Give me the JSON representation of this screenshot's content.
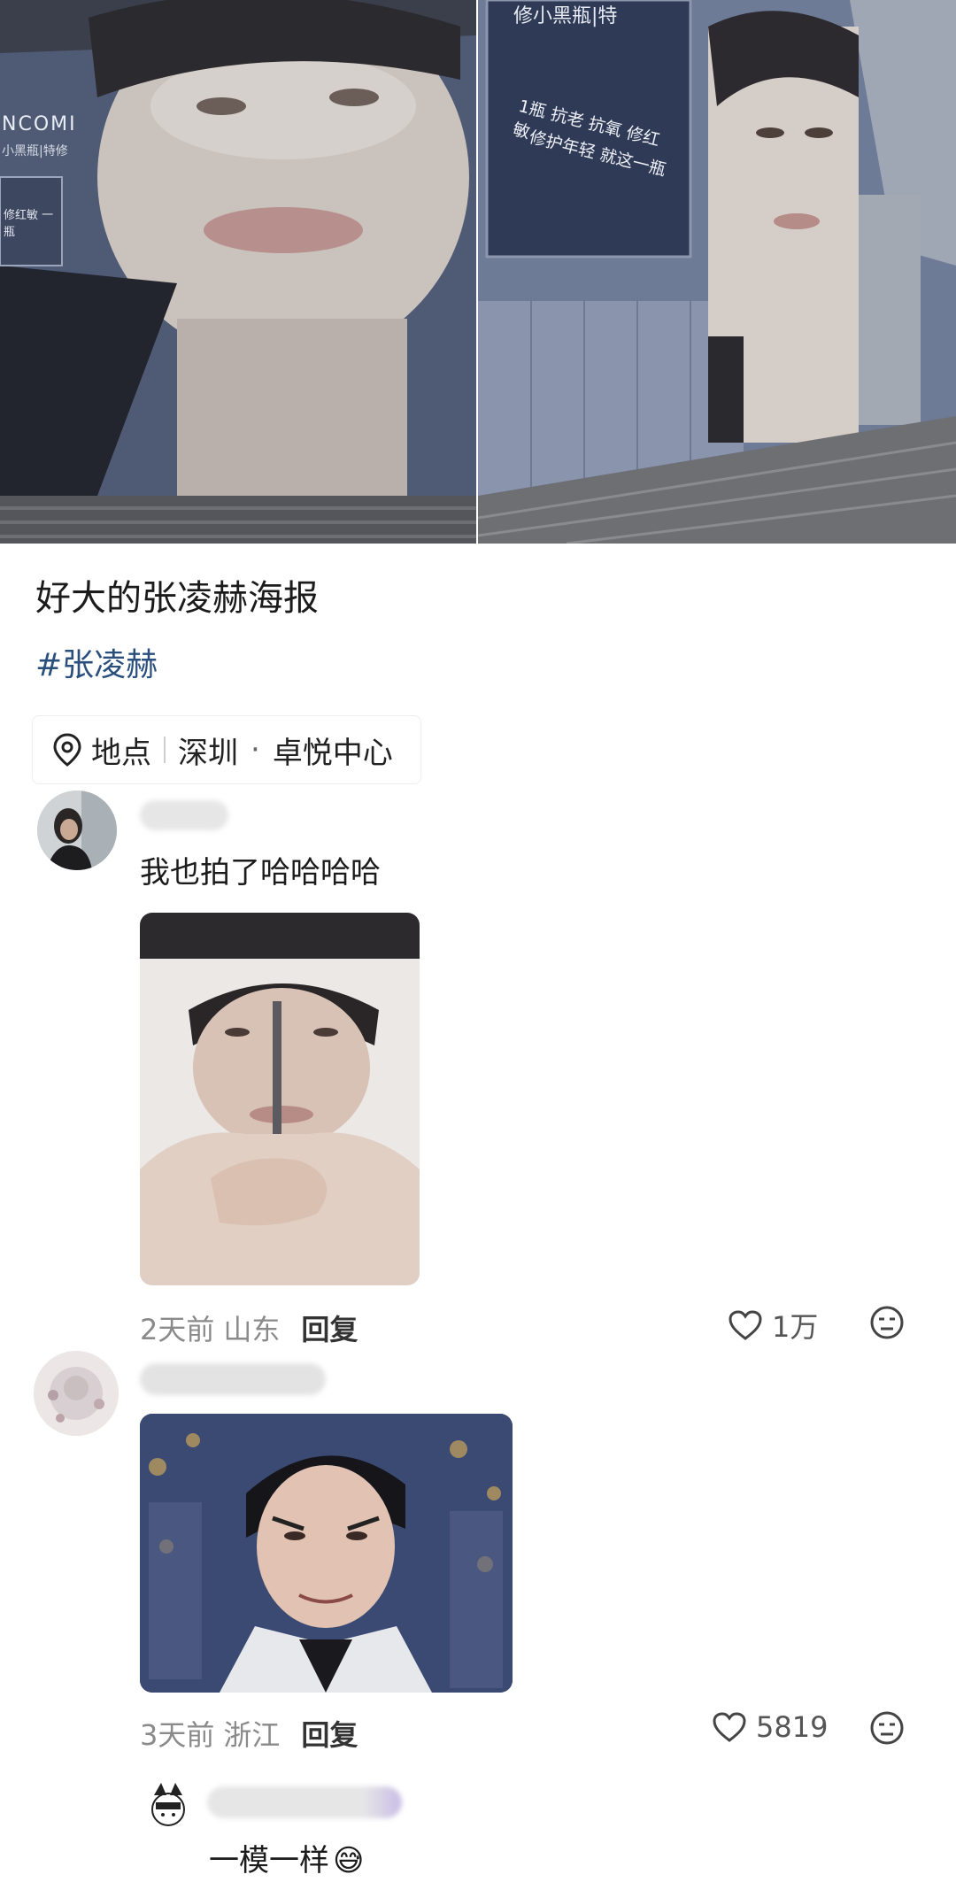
{
  "post": {
    "photo_left_brand": "NCOMI",
    "photo_left_badge": "小黑瓶|特修",
    "photo_left_sign": "修红敏 一瓶",
    "photo_right_brand": "修小黑瓶|特",
    "photo_right_line1": "1瓶 抗老 抗氧 修红敏",
    "photo_right_line2": "修护年轻 就这一瓶",
    "title": "好大的张凌赫海报",
    "hashtag": "#张凌赫",
    "location_label": "地点",
    "location_city": "深圳",
    "location_dot": "·",
    "location_place": "卓悦中心"
  },
  "comments": [
    {
      "text": "我也拍了哈哈哈哈",
      "time": "2天前",
      "region": "山东",
      "reply": "回复",
      "likes": "1万"
    },
    {
      "time": "3天前",
      "region": "浙江",
      "reply": "回复",
      "likes": "5819"
    },
    {
      "text": "一模一样",
      "emoji": "😅"
    }
  ],
  "colors": {
    "hashtag": "#2a4f7d",
    "meta": "#8a8a8a"
  }
}
